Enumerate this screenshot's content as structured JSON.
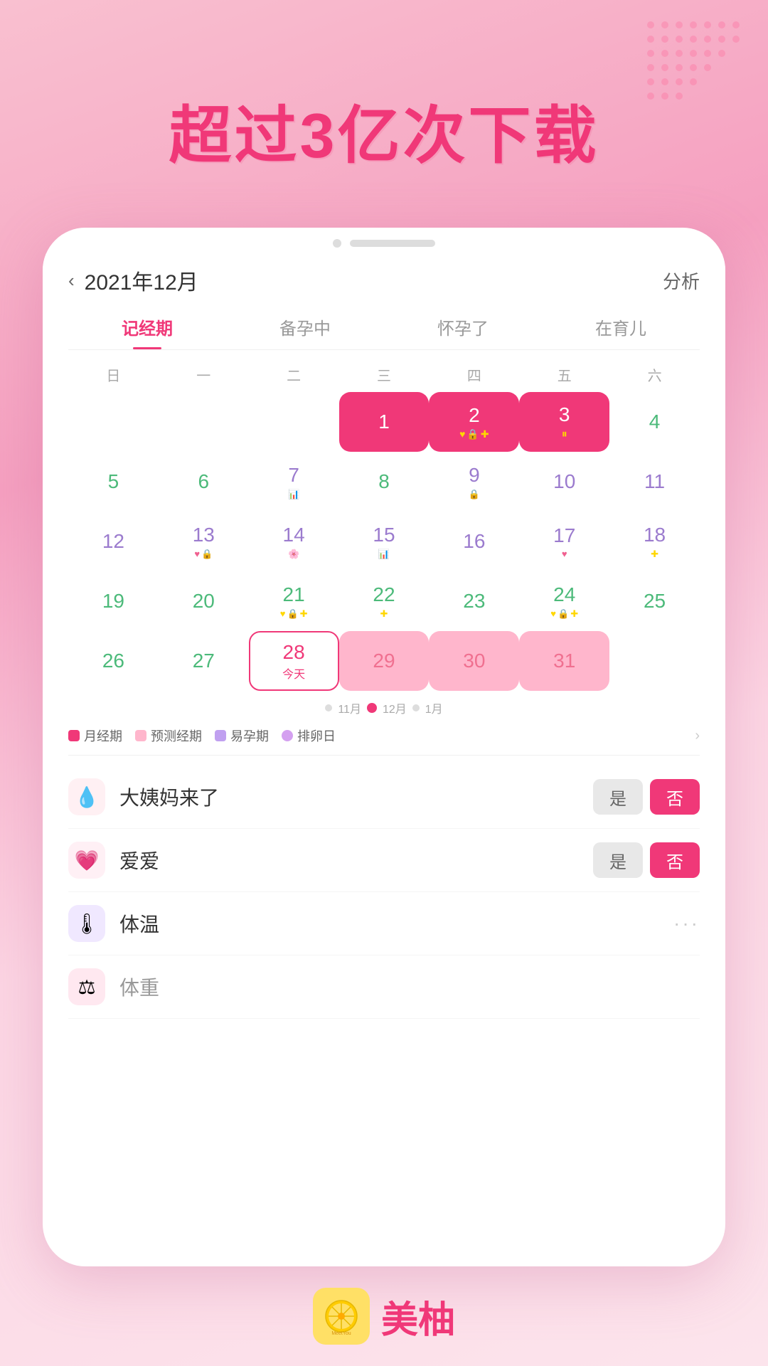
{
  "hero": {
    "title": "超过3亿次下载"
  },
  "header": {
    "back_label": "‹",
    "date": "2021年12月",
    "analysis": "分析"
  },
  "tabs": [
    {
      "label": "记经期",
      "active": true
    },
    {
      "label": "备孕中",
      "active": false
    },
    {
      "label": "怀孕了",
      "active": false
    },
    {
      "label": "在育儿",
      "active": false
    }
  ],
  "weekdays": [
    "日",
    "一",
    "二",
    "三",
    "四",
    "五",
    "六"
  ],
  "calendar": {
    "rows": [
      [
        {
          "num": "",
          "type": "empty"
        },
        {
          "num": "",
          "type": "empty"
        },
        {
          "num": "",
          "type": "empty"
        },
        {
          "num": "1",
          "type": "period",
          "icons": []
        },
        {
          "num": "2",
          "type": "period",
          "icons": [
            "💛",
            "🔒",
            "➕"
          ]
        },
        {
          "num": "3",
          "type": "period",
          "icons": [
            "⏸"
          ]
        },
        {
          "num": "4",
          "type": "normal",
          "color": "green",
          "icons": []
        }
      ],
      [
        {
          "num": "5",
          "type": "normal",
          "color": "green",
          "icons": []
        },
        {
          "num": "6",
          "type": "normal",
          "color": "green",
          "icons": []
        },
        {
          "num": "7",
          "type": "normal",
          "color": "purple",
          "icons": [
            "📊"
          ]
        },
        {
          "num": "8",
          "type": "normal",
          "color": "green",
          "icons": []
        },
        {
          "num": "9",
          "type": "normal",
          "color": "purple",
          "icons": [
            "🔒"
          ]
        },
        {
          "num": "10",
          "type": "normal",
          "color": "purple",
          "icons": []
        },
        {
          "num": "11",
          "type": "normal",
          "color": "purple",
          "icons": []
        }
      ],
      [
        {
          "num": "12",
          "type": "normal",
          "color": "purple",
          "icons": []
        },
        {
          "num": "13",
          "type": "normal",
          "color": "purple",
          "icons": [
            "💗",
            "🔒"
          ]
        },
        {
          "num": "14",
          "type": "normal",
          "color": "purple",
          "icons": [
            "🌸"
          ]
        },
        {
          "num": "15",
          "type": "normal",
          "color": "purple",
          "icons": [
            "📊"
          ]
        },
        {
          "num": "16",
          "type": "normal",
          "color": "purple",
          "icons": []
        },
        {
          "num": "17",
          "type": "normal",
          "color": "purple",
          "icons": [
            "💗"
          ]
        },
        {
          "num": "18",
          "type": "normal",
          "color": "purple",
          "icons": [
            "➕"
          ]
        }
      ],
      [
        {
          "num": "19",
          "type": "normal",
          "color": "green",
          "icons": []
        },
        {
          "num": "20",
          "type": "normal",
          "color": "green",
          "icons": []
        },
        {
          "num": "21",
          "type": "normal",
          "color": "green",
          "icons": [
            "💛",
            "🔒",
            "➕"
          ]
        },
        {
          "num": "22",
          "type": "normal",
          "color": "green",
          "icons": [
            "➕"
          ]
        },
        {
          "num": "23",
          "type": "normal",
          "color": "green",
          "icons": []
        },
        {
          "num": "24",
          "type": "normal",
          "color": "green",
          "icons": [
            "💛",
            "🔒",
            "➕"
          ]
        },
        {
          "num": "25",
          "type": "normal",
          "color": "green",
          "icons": []
        }
      ],
      [
        {
          "num": "26",
          "type": "normal",
          "color": "green",
          "icons": []
        },
        {
          "num": "27",
          "type": "normal",
          "color": "green",
          "icons": []
        },
        {
          "num": "28",
          "type": "today",
          "icons": [],
          "today_label": "今天"
        },
        {
          "num": "29",
          "type": "pred",
          "icons": []
        },
        {
          "num": "30",
          "type": "pred",
          "icons": []
        },
        {
          "num": "31",
          "type": "pred",
          "icons": []
        },
        {
          "num": "",
          "type": "empty"
        }
      ]
    ]
  },
  "pagination": {
    "labels": [
      "11月",
      "12月",
      "1月"
    ],
    "active_index": 1
  },
  "legend": [
    {
      "color": "period",
      "label": "月经期"
    },
    {
      "color": "pred",
      "label": "预测经期"
    },
    {
      "color": "easy",
      "label": "易孕期"
    },
    {
      "color": "ovulation",
      "label": "排卵日"
    }
  ],
  "log_items": [
    {
      "icon": "💧",
      "icon_class": "red",
      "label": "大姨妈来了",
      "has_buttons": true,
      "yes": "是",
      "no": "否"
    },
    {
      "icon": "💗",
      "icon_class": "pink-heart",
      "label": "爱爱",
      "has_buttons": true,
      "yes": "是",
      "no": "否"
    },
    {
      "icon": "🌡",
      "icon_class": "purple-temp",
      "label": "体温",
      "has_more": true
    },
    {
      "icon": "⚖",
      "icon_class": "weight",
      "label": "体重",
      "has_more": false,
      "faded": true
    }
  ],
  "brand": {
    "name": "美柚",
    "logo_emoji": "🍊",
    "meetyou_label": "Meetyou"
  }
}
